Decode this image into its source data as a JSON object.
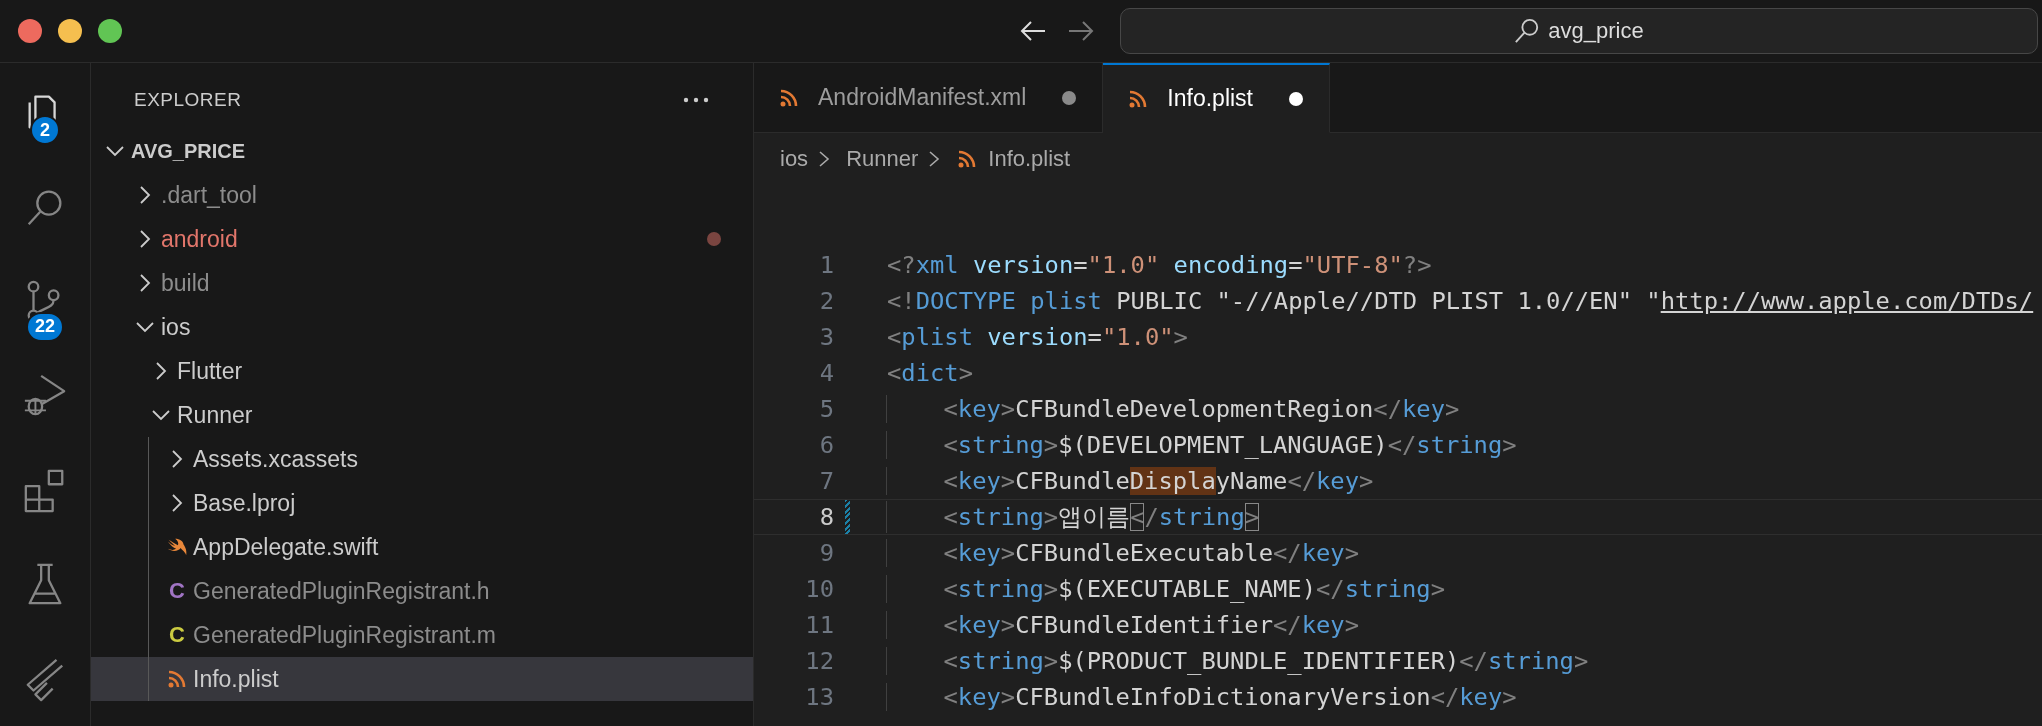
{
  "title_bar": {
    "back_disabled": false,
    "forward_disabled": true,
    "search": "avg_price"
  },
  "activity_bar": [
    {
      "kind": "files",
      "badge": "2",
      "selected": true
    },
    {
      "kind": "search",
      "selected": false
    },
    {
      "kind": "scm",
      "badge": "22",
      "selected": false
    },
    {
      "kind": "run",
      "selected": false
    },
    {
      "kind": "extensions",
      "selected": false
    },
    {
      "kind": "testing",
      "selected": false
    },
    {
      "kind": "flutter",
      "selected": false
    }
  ],
  "explorer": {
    "title": "EXPLORER",
    "tree": [
      {
        "kind": "root",
        "label": "AVG_PRICE",
        "expanded": true,
        "dimmed": false,
        "modified": false,
        "selected": false,
        "children": [
          {
            "kind": "folder",
            "label": ".dart_tool",
            "expanded": false,
            "dimmed": true,
            "modified": false,
            "selected": false
          },
          {
            "kind": "folder",
            "label": "android",
            "expanded": false,
            "dimmed": false,
            "modified": true,
            "selected": false
          },
          {
            "kind": "folder",
            "label": "build",
            "expanded": false,
            "dimmed": true,
            "modified": false,
            "selected": false
          },
          {
            "kind": "folder",
            "label": "ios",
            "expanded": true,
            "dimmed": false,
            "modified": false,
            "selected": false,
            "children": [
              {
                "kind": "folder",
                "label": "Flutter",
                "expanded": false,
                "dimmed": false,
                "modified": false,
                "selected": false
              },
              {
                "kind": "folder",
                "label": "Runner",
                "expanded": true,
                "dimmed": false,
                "modified": false,
                "selected": false,
                "children": [
                  {
                    "kind": "folder",
                    "label": "Assets.xcassets",
                    "expanded": false,
                    "dimmed": false,
                    "modified": false,
                    "selected": false
                  },
                  {
                    "kind": "folder",
                    "label": "Base.lproj",
                    "expanded": false,
                    "dimmed": false,
                    "modified": false,
                    "selected": false
                  },
                  {
                    "kind": "swift",
                    "label": "AppDelegate.swift",
                    "dimmed": false,
                    "modified": false,
                    "selected": false
                  },
                  {
                    "kind": "c",
                    "label": "GeneratedPluginRegistrant.h",
                    "glyph": "C",
                    "color": "#a074c4",
                    "dimmed": true,
                    "modified": false,
                    "selected": false
                  },
                  {
                    "kind": "c",
                    "label": "GeneratedPluginRegistrant.m",
                    "glyph": "C",
                    "color": "#cbcb41",
                    "dimmed": true,
                    "modified": false,
                    "selected": false
                  },
                  {
                    "kind": "feed",
                    "label": "Info.plist",
                    "dimmed": false,
                    "modified": false,
                    "selected": true
                  }
                ]
              }
            ]
          }
        ]
      }
    ]
  },
  "tabs": [
    {
      "label": "AndroidManifest.xml",
      "modified": true,
      "selected": false
    },
    {
      "label": "Info.plist",
      "modified": true,
      "selected": true
    }
  ],
  "breadcrumb": [
    {
      "label": "ios",
      "kind": "folder"
    },
    {
      "label": "Runner",
      "kind": "folder"
    },
    {
      "label": "Info.plist",
      "kind": "feed"
    }
  ],
  "code": [
    {
      "number": "1",
      "indented": false,
      "current": false,
      "modified": false,
      "tokens": [
        {
          "kind": "punct",
          "text": "<?"
        },
        {
          "kind": "tag",
          "text": "xml"
        },
        {
          "kind": "attr",
          "text": " version"
        },
        {
          "kind": "text",
          "text": "="
        },
        {
          "kind": "value",
          "text": "\"1.0\""
        },
        {
          "kind": "attr",
          "text": " encoding"
        },
        {
          "kind": "text",
          "text": "="
        },
        {
          "kind": "value",
          "text": "\"UTF-8\""
        },
        {
          "kind": "punct",
          "text": "?>"
        }
      ]
    },
    {
      "number": "2",
      "indented": false,
      "current": false,
      "modified": false,
      "tokens": [
        {
          "kind": "punct",
          "text": "<!"
        },
        {
          "kind": "tag",
          "text": "DOCTYPE plist"
        },
        {
          "kind": "text",
          "text": " PUBLIC \"-//Apple//DTD PLIST 1.0//EN\" \""
        },
        {
          "kind": "link",
          "text": "http://www.apple.com/DTDs/"
        }
      ]
    },
    {
      "number": "3",
      "indented": false,
      "current": false,
      "modified": false,
      "tokens": [
        {
          "kind": "punct",
          "text": "<"
        },
        {
          "kind": "tag",
          "text": "plist"
        },
        {
          "kind": "attr",
          "text": " version"
        },
        {
          "kind": "text",
          "text": "="
        },
        {
          "kind": "value",
          "text": "\"1.0\""
        },
        {
          "kind": "punct",
          "text": ">"
        }
      ]
    },
    {
      "number": "4",
      "indented": false,
      "current": false,
      "modified": false,
      "tokens": [
        {
          "kind": "punct",
          "text": "<"
        },
        {
          "kind": "tag",
          "text": "dict"
        },
        {
          "kind": "punct",
          "text": ">"
        }
      ]
    },
    {
      "number": "5",
      "indented": true,
      "current": false,
      "modified": false,
      "tokens": [
        {
          "kind": "punct",
          "text": "<"
        },
        {
          "kind": "tag",
          "text": "key"
        },
        {
          "kind": "punct",
          "text": ">"
        },
        {
          "kind": "text",
          "text": "CFBundleDevelopmentRegion"
        },
        {
          "kind": "punct",
          "text": "</"
        },
        {
          "kind": "tag",
          "text": "key"
        },
        {
          "kind": "punct",
          "text": ">"
        }
      ]
    },
    {
      "number": "6",
      "indented": true,
      "current": false,
      "modified": false,
      "tokens": [
        {
          "kind": "punct",
          "text": "<"
        },
        {
          "kind": "tag",
          "text": "string"
        },
        {
          "kind": "punct",
          "text": ">"
        },
        {
          "kind": "text",
          "text": "$(DEVELOPMENT_LANGUAGE)"
        },
        {
          "kind": "punct",
          "text": "</"
        },
        {
          "kind": "tag",
          "text": "string"
        },
        {
          "kind": "punct",
          "text": ">"
        }
      ]
    },
    {
      "number": "7",
      "indented": true,
      "current": false,
      "modified": false,
      "tokens": [
        {
          "kind": "punct",
          "text": "<"
        },
        {
          "kind": "tag",
          "text": "key"
        },
        {
          "kind": "punct",
          "text": ">"
        },
        {
          "kind": "text",
          "text": "CFBundle"
        },
        {
          "kind": "highlight",
          "text": "Displa"
        },
        {
          "kind": "text",
          "text": "yName"
        },
        {
          "kind": "punct",
          "text": "</"
        },
        {
          "kind": "tag",
          "text": "key"
        },
        {
          "kind": "punct",
          "text": ">"
        }
      ]
    },
    {
      "number": "8",
      "indented": true,
      "current": true,
      "modified": true,
      "tokens": [
        {
          "kind": "punct",
          "text": "<"
        },
        {
          "kind": "tag",
          "text": "string"
        },
        {
          "kind": "punct",
          "text": ">"
        },
        {
          "kind": "text",
          "text": "앱이름"
        },
        {
          "kind": "match",
          "text": "<"
        },
        {
          "kind": "punct",
          "text": "/"
        },
        {
          "kind": "tag",
          "text": "string"
        },
        {
          "kind": "match",
          "text": ">"
        }
      ]
    },
    {
      "number": "9",
      "indented": true,
      "current": false,
      "modified": false,
      "tokens": [
        {
          "kind": "punct",
          "text": "<"
        },
        {
          "kind": "tag",
          "text": "key"
        },
        {
          "kind": "punct",
          "text": ">"
        },
        {
          "kind": "text",
          "text": "CFBundleExecutable"
        },
        {
          "kind": "punct",
          "text": "</"
        },
        {
          "kind": "tag",
          "text": "key"
        },
        {
          "kind": "punct",
          "text": ">"
        }
      ]
    },
    {
      "number": "10",
      "indented": true,
      "current": false,
      "modified": false,
      "tokens": [
        {
          "kind": "punct",
          "text": "<"
        },
        {
          "kind": "tag",
          "text": "string"
        },
        {
          "kind": "punct",
          "text": ">"
        },
        {
          "kind": "text",
          "text": "$(EXECUTABLE_NAME)"
        },
        {
          "kind": "punct",
          "text": "</"
        },
        {
          "kind": "tag",
          "text": "string"
        },
        {
          "kind": "punct",
          "text": ">"
        }
      ]
    },
    {
      "number": "11",
      "indented": true,
      "current": false,
      "modified": false,
      "tokens": [
        {
          "kind": "punct",
          "text": "<"
        },
        {
          "kind": "tag",
          "text": "key"
        },
        {
          "kind": "punct",
          "text": ">"
        },
        {
          "kind": "text",
          "text": "CFBundleIdentifier"
        },
        {
          "kind": "punct",
          "text": "</"
        },
        {
          "kind": "tag",
          "text": "key"
        },
        {
          "kind": "punct",
          "text": ">"
        }
      ]
    },
    {
      "number": "12",
      "indented": true,
      "current": false,
      "modified": false,
      "tokens": [
        {
          "kind": "punct",
          "text": "<"
        },
        {
          "kind": "tag",
          "text": "string"
        },
        {
          "kind": "punct",
          "text": ">"
        },
        {
          "kind": "text",
          "text": "$(PRODUCT_BUNDLE_IDENTIFIER)"
        },
        {
          "kind": "punct",
          "text": "</"
        },
        {
          "kind": "tag",
          "text": "string"
        },
        {
          "kind": "punct",
          "text": ">"
        }
      ]
    },
    {
      "number": "13",
      "indented": true,
      "current": false,
      "modified": false,
      "tokens": [
        {
          "kind": "punct",
          "text": "<"
        },
        {
          "kind": "tag",
          "text": "key"
        },
        {
          "kind": "punct",
          "text": ">"
        },
        {
          "kind": "text",
          "text": "CFBundleInfoDictionaryVersion"
        },
        {
          "kind": "punct",
          "text": "</"
        },
        {
          "kind": "tag",
          "text": "key"
        },
        {
          "kind": "punct",
          "text": ">"
        }
      ]
    }
  ]
}
